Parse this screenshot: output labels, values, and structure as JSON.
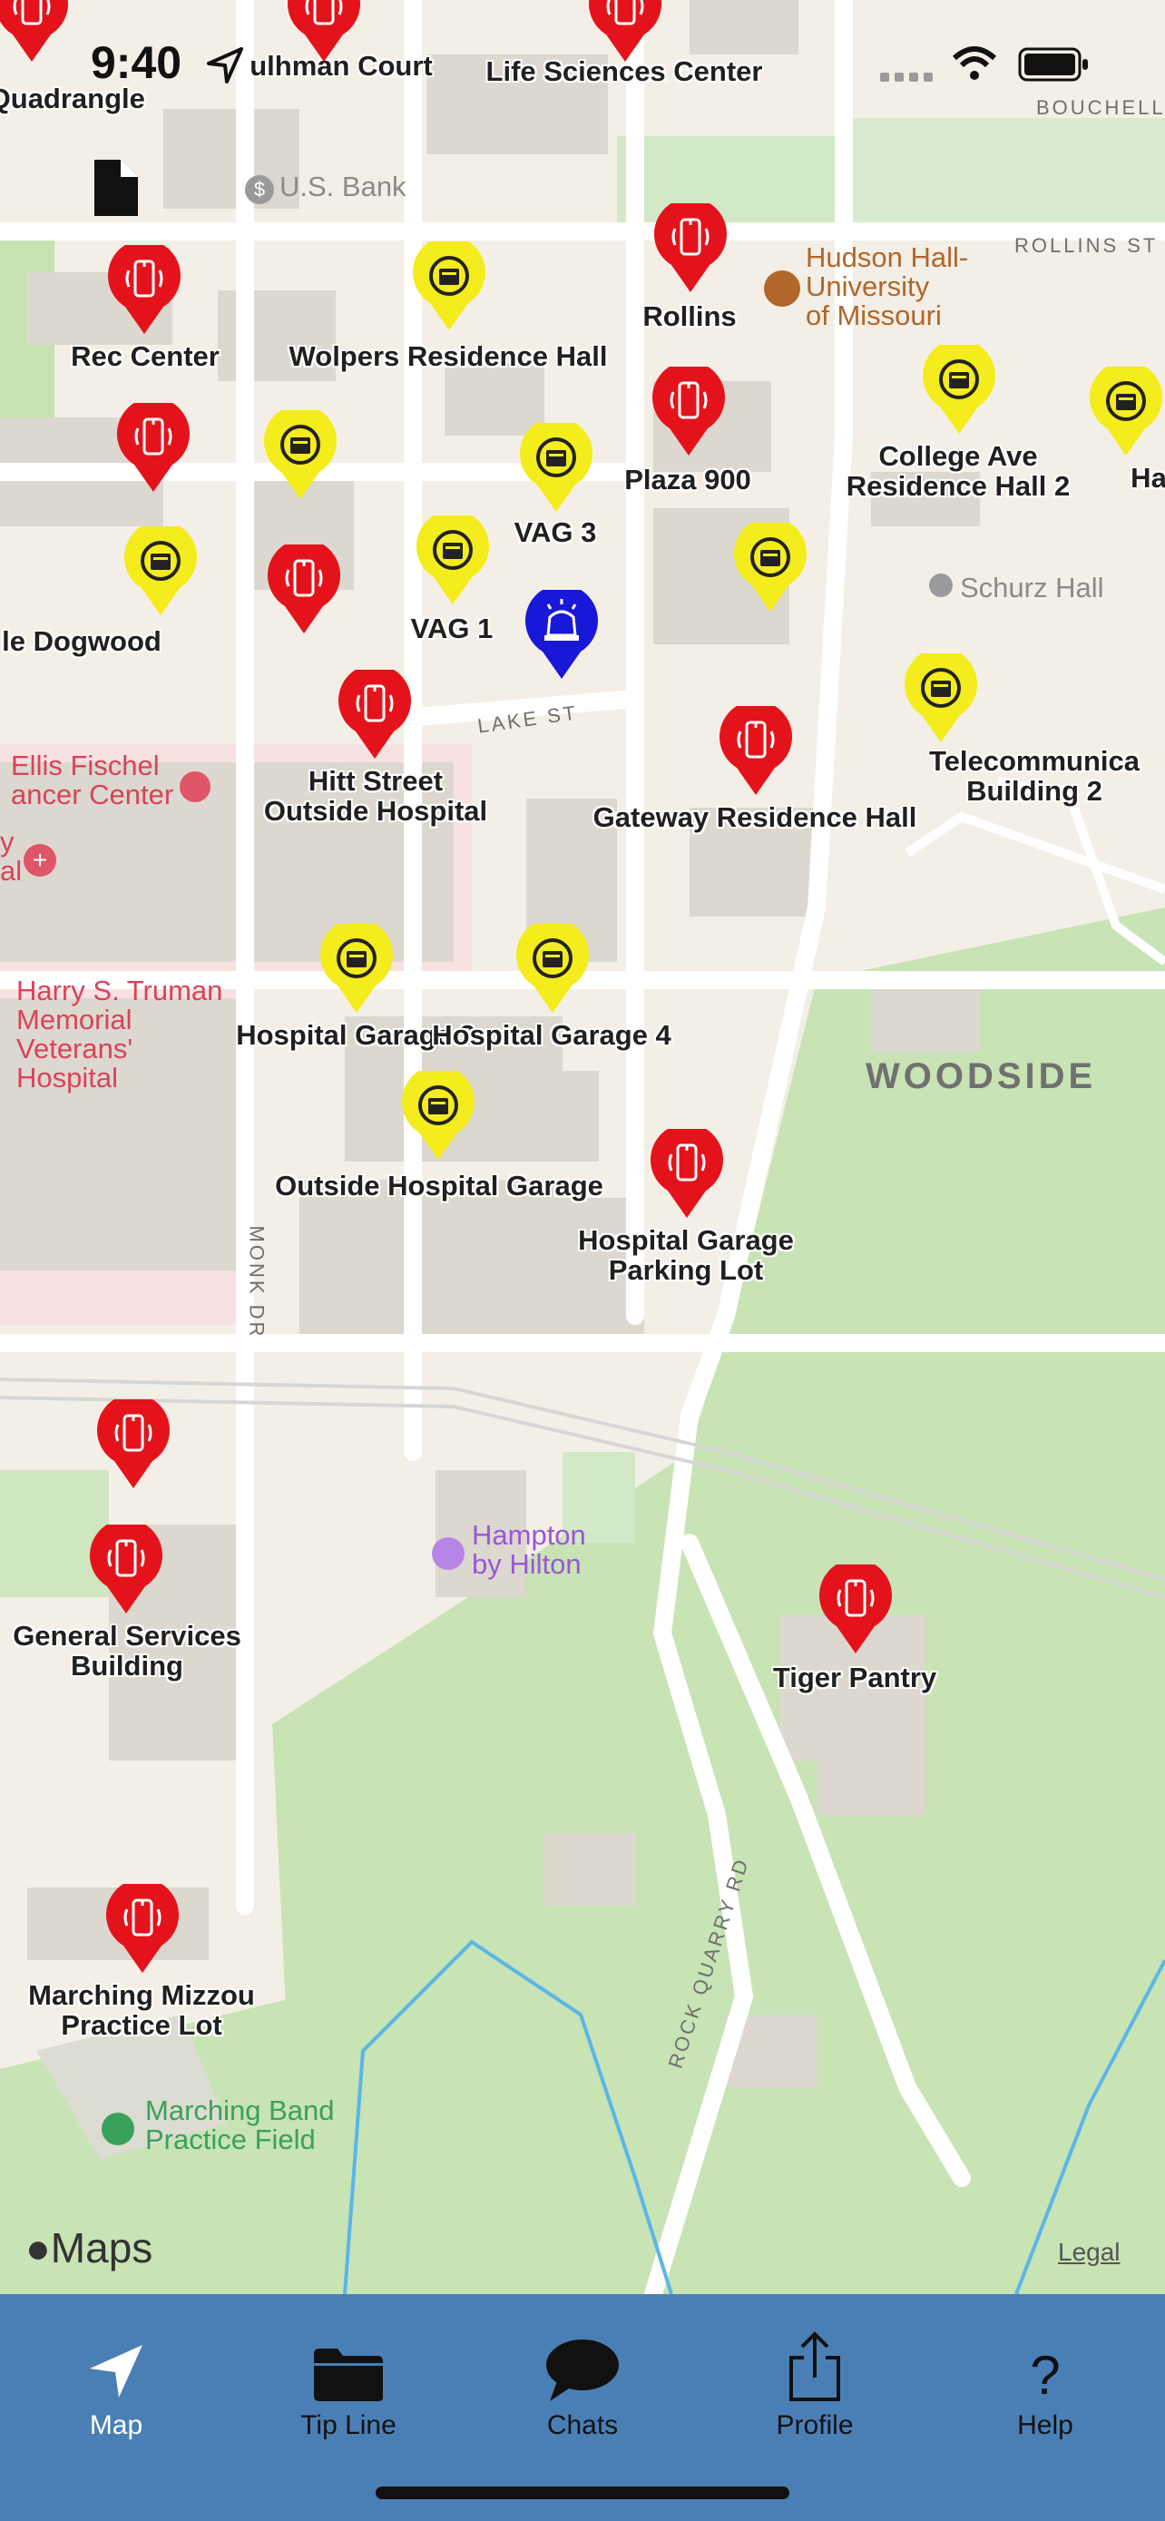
{
  "status_bar": {
    "time": "9:40"
  },
  "map": {
    "pins": [
      {
        "id": "pin-top-left",
        "type": "red",
        "label": ""
      },
      {
        "id": "pin-top-pulhman",
        "type": "red",
        "label": ""
      },
      {
        "id": "pin-top-life",
        "type": "red",
        "label": ""
      },
      {
        "id": "pin-rec-center",
        "type": "red",
        "label": "Rec Center"
      },
      {
        "id": "pin-wolpers",
        "type": "yellow",
        "label": "Wolpers Residence Hall"
      },
      {
        "id": "pin-rollins",
        "type": "red",
        "label": "Rollins"
      },
      {
        "id": "pin-college-ave",
        "type": "yellow",
        "label": "College Ave\nResidence Hall 2"
      },
      {
        "id": "pin-hatch",
        "type": "yellow",
        "label": "Ha"
      },
      {
        "id": "pin-red-mid-left",
        "type": "red",
        "label": ""
      },
      {
        "id": "pin-yellow-mid-left",
        "type": "yellow",
        "label": ""
      },
      {
        "id": "pin-vag3",
        "type": "yellow",
        "label": "VAG 3"
      },
      {
        "id": "pin-plaza900",
        "type": "red",
        "label": "Plaza 900"
      },
      {
        "id": "pin-dogwood",
        "type": "yellow",
        "label": "le Dogwood"
      },
      {
        "id": "pin-red-center",
        "type": "red",
        "label": ""
      },
      {
        "id": "pin-vag1",
        "type": "yellow",
        "label": "VAG 1"
      },
      {
        "id": "pin-alert",
        "type": "blue",
        "label": ""
      },
      {
        "id": "pin-yellow-right",
        "type": "yellow",
        "label": ""
      },
      {
        "id": "pin-telecom",
        "type": "yellow",
        "label": "Telecommunica\nBuilding 2"
      },
      {
        "id": "pin-hitt",
        "type": "red",
        "label": "Hitt Street\nOutside Hospital"
      },
      {
        "id": "pin-gateway",
        "type": "red",
        "label": "Gateway Residence Hall"
      },
      {
        "id": "pin-garage3",
        "type": "yellow",
        "label": "Hospital Garage 3"
      },
      {
        "id": "pin-garage4",
        "type": "yellow",
        "label": "Hospital Garage 4"
      },
      {
        "id": "pin-outside-garage",
        "type": "yellow",
        "label": "Outside Hospital Garage"
      },
      {
        "id": "pin-garage-parking",
        "type": "red",
        "label": "Hospital Garage\nParking Lot"
      },
      {
        "id": "pin-red-lower-left",
        "type": "red",
        "label": ""
      },
      {
        "id": "pin-general-services",
        "type": "red",
        "label": "General Services\nBuilding"
      },
      {
        "id": "pin-tiger-pantry",
        "type": "red",
        "label": "Tiger Pantry"
      },
      {
        "id": "pin-marching",
        "type": "red",
        "label": "Marching Mizzou\nPractice Lot"
      }
    ],
    "places": {
      "quadrangle": "n Quadrangle",
      "pulhman": "ulhman Court",
      "life_sciences": "Life Sciences Center",
      "us_bank": "U.S. Bank",
      "hudson": "Hudson Hall-\nUniversity\nof Missouri",
      "schurz": "Schurz Hall",
      "ellis": "Ellis Fischel\nancer Center",
      "y_al": "y\nal",
      "truman": "Harry S. Truman\nMemorial\nVeterans'\nHospital",
      "woodside": "WOODSIDE",
      "hampton": "Hampton\nby Hilton",
      "marching_field": "Marching Band\nPractice Field"
    },
    "roads": {
      "bouchelle": "BOUCHELLE",
      "rollins_st": "ROLLINS ST",
      "lake_st": "LAKE ST",
      "monk_dr": "MONK DR",
      "rock_quarry": "ROCK QUARRY RD"
    },
    "attribution": {
      "logo": "Maps",
      "legal": "Legal"
    }
  },
  "tabbar": {
    "tabs": [
      {
        "label": "Map",
        "icon": "location-arrow-icon",
        "active": true
      },
      {
        "label": "Tip Line",
        "icon": "folder-icon",
        "active": false
      },
      {
        "label": "Chats",
        "icon": "chat-bubble-icon",
        "active": false
      },
      {
        "label": "Profile",
        "icon": "share-icon",
        "active": false
      },
      {
        "label": "Help",
        "icon": "question-icon",
        "active": false
      }
    ]
  },
  "colors": {
    "tab_bar": "#4a7fb6",
    "pin_red": "#e4131b",
    "pin_yellow": "#f4ec1c",
    "pin_blue": "#1a18d8"
  }
}
